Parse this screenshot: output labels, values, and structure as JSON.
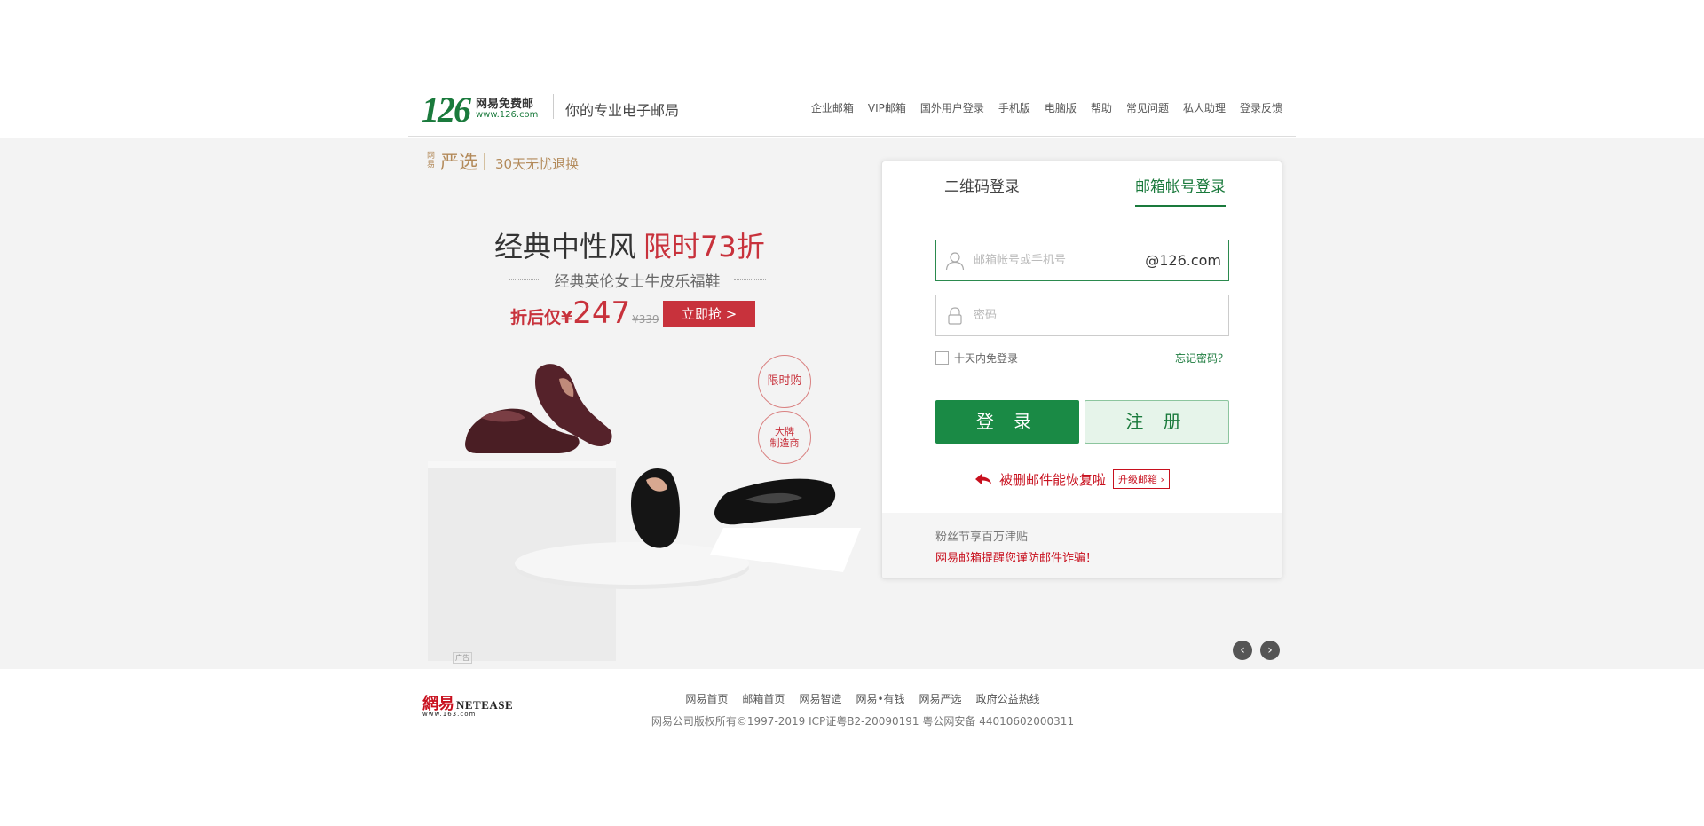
{
  "header": {
    "logo_number": "126",
    "logo_name": "网易免费邮",
    "logo_url": "www.126.com",
    "slogan": "你的专业电子邮局",
    "nav": [
      "企业邮箱",
      "VIP邮箱",
      "国外用户登录",
      "手机版",
      "电脑版",
      "帮助",
      "常见问题",
      "私人助理",
      "登录反馈"
    ]
  },
  "ad": {
    "brand_small": "网易",
    "brand_name": "严选",
    "tagline": "30天无忧退换",
    "title": "经典中性风",
    "title_highlight": "限时73折",
    "subtitle": "经典英伦女士牛皮乐福鞋",
    "price_prefix": "折后仅¥",
    "price": "247",
    "original_price": "¥339",
    "cta": "立即抢 >",
    "badge1": "限时购",
    "badge2_line1": "大牌",
    "badge2_line2": "制造商",
    "ad_label": "广告"
  },
  "login": {
    "tab_qr": "二维码登录",
    "tab_account": "邮箱帐号登录",
    "user_placeholder": "邮箱帐号或手机号",
    "domain": "@126.com",
    "password_placeholder": "密码",
    "remember": "十天内免登录",
    "forgot": "忘记密码？",
    "login_button": "登 录",
    "register_button": "注 册",
    "promo_text": "被删邮件能恢复啦",
    "promo_button": "升级邮箱",
    "footer_line1": "粉丝节享百万津贴",
    "footer_line2": "网易邮箱提醒您谨防邮件诈骗！"
  },
  "slider": {
    "prev": "‹",
    "next": "›"
  },
  "footer": {
    "logo_cn": "網易",
    "logo_en": "NETEASE",
    "logo_url": "www.163.com",
    "links": [
      "网易首页",
      "邮箱首页",
      "网易智造",
      "网易•有钱",
      "网易严选",
      "政府公益热线"
    ],
    "copyright": "网易公司版权所有©1997-2019   ICP证粤B2-20090191   粤公网安备 44010602000311"
  },
  "colors": {
    "brand_green": "#1a7a3c",
    "login_green": "#1a8a45",
    "accent_red": "#c8323c"
  },
  "icons": [
    "user-icon",
    "lock-icon",
    "back-arrow-icon",
    "chevron-left-icon",
    "chevron-right-icon"
  ]
}
